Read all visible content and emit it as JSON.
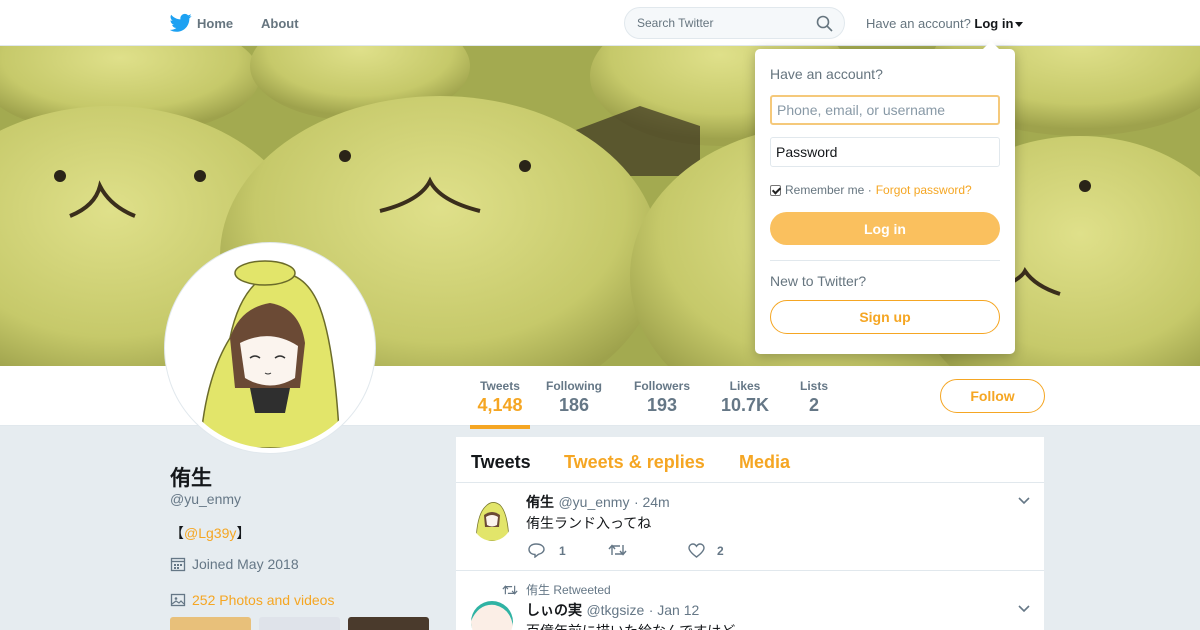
{
  "topnav": {
    "home_label": "Home",
    "about_label": "About",
    "search_placeholder": "Search Twitter",
    "have_account_label": "Have an account?",
    "login_label": "Log in"
  },
  "profile_nav": {
    "stats": [
      {
        "label": "Tweets",
        "value": "4,148"
      },
      {
        "label": "Following",
        "value": "186"
      },
      {
        "label": "Followers",
        "value": "193"
      },
      {
        "label": "Likes",
        "value": "10.7K"
      },
      {
        "label": "Lists",
        "value": "2"
      }
    ],
    "active_stat": "Tweets",
    "follow_label": "Follow"
  },
  "profile": {
    "name": "侑生",
    "handle": "@yu_enmy",
    "bio_prefix": "【",
    "bio_link": "@Lg39y",
    "bio_suffix": "】",
    "joined": "Joined May 2018",
    "photos": "252 Photos and videos"
  },
  "timeline": {
    "tabs": [
      "Tweets",
      "Tweets & replies",
      "Media"
    ],
    "active_tab": "Tweets",
    "tweets": [
      {
        "name": "侑生",
        "handle": "@yu_enmy",
        "time": "· 24m",
        "text": "侑生ランド入ってね",
        "replies": "1",
        "retweets": "",
        "likes": "2"
      },
      {
        "retweet_note": "侑生 Retweeted",
        "name": "しぃの実",
        "handle": "@tkgsize",
        "time": "· Jan 12",
        "text": "百億年前に描いた絵なんですけど"
      }
    ]
  },
  "login_dropdown": {
    "title": "Have an account?",
    "username_placeholder": "Phone, email, or username",
    "password_placeholder": "Password",
    "remember_label": "Remember me ·",
    "forgot_label": "Forgot password?",
    "login_button": "Log in",
    "new_label": "New to Twitter?",
    "signup_button": "Sign up"
  },
  "colors": {
    "accent": "#f5a623",
    "twitter_blue": "#1da1f2",
    "login_button": "#fac05e"
  }
}
